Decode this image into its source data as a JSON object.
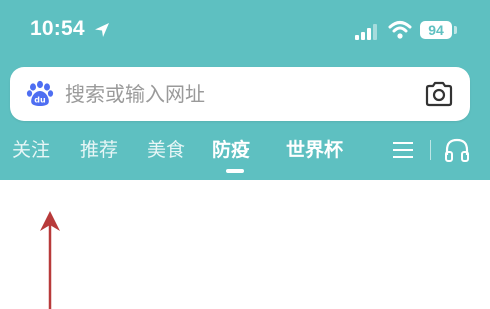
{
  "status_bar": {
    "time": "10:54",
    "battery": "94",
    "icons": [
      "location-arrow-icon",
      "signal-bars-icon",
      "wifi-icon",
      "battery-icon"
    ]
  },
  "search": {
    "placeholder": "搜索或输入网址",
    "icons": [
      "baidu-paw-icon",
      "camera-icon"
    ]
  },
  "tabs": [
    {
      "label": "关注"
    },
    {
      "label": "推荐"
    },
    {
      "label": "美食"
    },
    {
      "label": "防疫",
      "active": true
    },
    {
      "label": "世界杯"
    }
  ],
  "tab_icons": [
    "menu-icon",
    "headphones-icon"
  ],
  "colors": {
    "header_bg": "#5ec0c1",
    "annotation_arrow": "#b83a3a"
  }
}
